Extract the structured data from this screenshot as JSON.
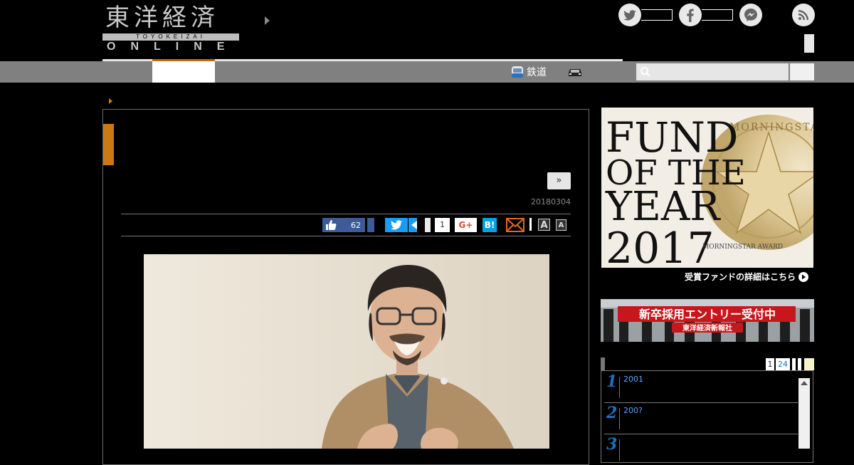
{
  "header": {
    "logo_kanji": "東洋経済",
    "logo_romaji": "TOYOKEIZAI",
    "logo_online": "ONLINE"
  },
  "nav": {
    "rail_label": "鉄道",
    "icons": [
      "rail-icon",
      "car-icon",
      "search-icon"
    ]
  },
  "article": {
    "next_label": "»",
    "date": "20180304",
    "like_count": "62",
    "pocket_count": "1",
    "gplus_label": "G+",
    "hatena_label": "B!",
    "font_large_label": "A",
    "font_small_label": "A"
  },
  "sidebar": {
    "fund_ad": {
      "line1": "FUND",
      "line2": "OF THE",
      "line3": "YEAR",
      "line4": "2017",
      "award_label": "MORNINGSTAR AWARD",
      "seal_text": "MORNINGSTAR",
      "link_text": "受賞ファンドの詳細はこちら"
    },
    "recruit_ad": {
      "headline": "新卒採用エントリー受付中",
      "company": "東洋経済新報社"
    },
    "ranking": {
      "tab_1": "1",
      "tab_24": "24",
      "items": [
        {
          "num": "1",
          "title": "2001"
        },
        {
          "num": "2",
          "title": "200?"
        },
        {
          "num": "3",
          "title": ""
        }
      ]
    }
  },
  "colors": {
    "accent_orange": "#c97a12",
    "nav_gray": "#808080",
    "ranking_blue": "#1f6fc0"
  }
}
